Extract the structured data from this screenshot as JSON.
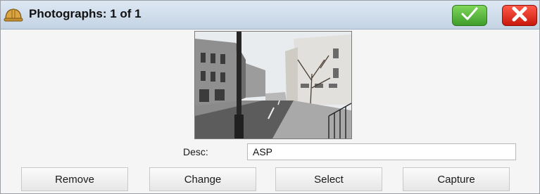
{
  "window": {
    "title": "Photographs: 1 of 1",
    "app_icon": "hard-hat-icon",
    "ok_icon": "checkmark-icon",
    "cancel_icon": "close-x-icon"
  },
  "photo": {
    "description": "street scene photo"
  },
  "desc": {
    "label": "Desc:",
    "value": "ASP"
  },
  "buttons": {
    "remove": "Remove",
    "change": "Change",
    "select": "Select",
    "capture": "Capture"
  },
  "colors": {
    "ok_green": "#4caf36",
    "cancel_red": "#e0261a",
    "titlebar": "#d2dfec"
  }
}
